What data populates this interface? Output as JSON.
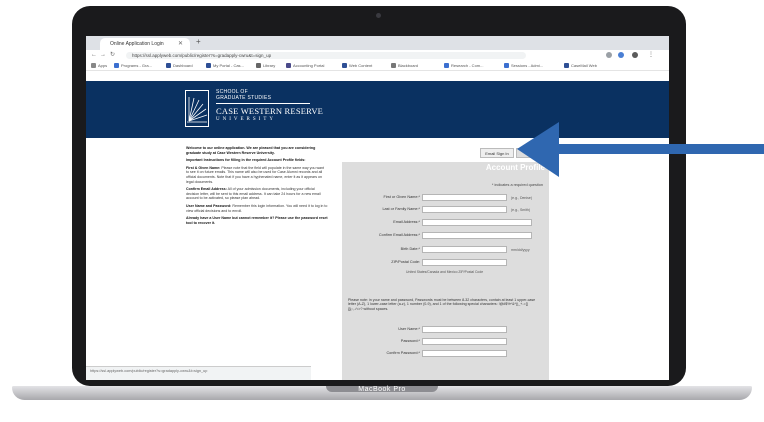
{
  "device": {
    "model_label": "MacBook Pro"
  },
  "browser": {
    "tab_title": "Online Application Login",
    "url": "https://ssl.applyweb.com/public/register?s=gradapply-cwru&t=sign_up",
    "bookmarks": [
      "Apps",
      "Programs - Gra...",
      "Dashboard",
      "My Portal - Cas...",
      "Library",
      "Accounting Portal",
      "Web Content",
      "Blackboard",
      "Research - Com...",
      "Sessions - Admi...",
      "CaseMail Web"
    ]
  },
  "site": {
    "logo_line1": "SCHOOL OF",
    "logo_line2": "GRADUATE STUDIES",
    "logo_name": "CASE WESTERN RESERVE",
    "logo_sub": "UNIVERSITY"
  },
  "intro": {
    "welcome": "Welcome to our online application. We are pleased that you are considering graduate study at Case Western Reserve University.",
    "important": "Important Instructions for filling in the required Account Profile fields:",
    "names_heading": "First & Given Name:",
    "names_text": "Please note that the field will populate in the same way you want to see it on future emails. This name will also be used for Case Alumni records and all official documents. Note that if you have a hyphenated name, enter it as it appears on legal documents.",
    "email_heading": "Confirm Email Address:",
    "email_text": "All of your admission documents, including your official decision letter, will be sent to this email address. It can take 24 hours for a new email account to be activated, so please plan ahead.",
    "user_heading": "User Name and Password:",
    "user_text": "Remember this login information. You will need it to log in to view official decisions and to enroll.",
    "already": "Already have a User Name but cannot remember it? Please use the password reset tool to recover it."
  },
  "form": {
    "sign_in_label": "Email Sign In",
    "sign_up_label": "Sign Up",
    "title": "Account Profile",
    "required_note": "* indicates a required question",
    "fields": [
      {
        "label": "First or Given Name:*",
        "hint": "(e.g., Denise)"
      },
      {
        "label": "Last or Family Name:*",
        "hint": "(e.g., Smith)"
      },
      {
        "label": "Email Address:*",
        "hint": ""
      },
      {
        "label": "Confirm Email Address:*",
        "hint": ""
      },
      {
        "label": "Birth Date:*",
        "hint": "mm/dd/yyyy"
      },
      {
        "label": "ZIP/Postal Code:",
        "hint": ""
      }
    ],
    "zip_note": "United States/Canada and Mexico ZIP/Postal Code",
    "password_note": "Please note: in your name and password, Passwords must be between 8-32 characters, contain at least 1 upper-case letter (A-Z), 1 lower-case letter (a-z), 1 number (0-9), and 1 of the following special characters: !@#$%^&*()_+-=[]{}|;:,./<>? without spaces.",
    "account_fields": [
      {
        "label": "User Name:*"
      },
      {
        "label": "Password:*"
      },
      {
        "label": "Confirm Password:*"
      }
    ]
  },
  "status_bar": "https://ssl.applyweb.com/public/register?s=gradapply-cwru&t=sign_up"
}
